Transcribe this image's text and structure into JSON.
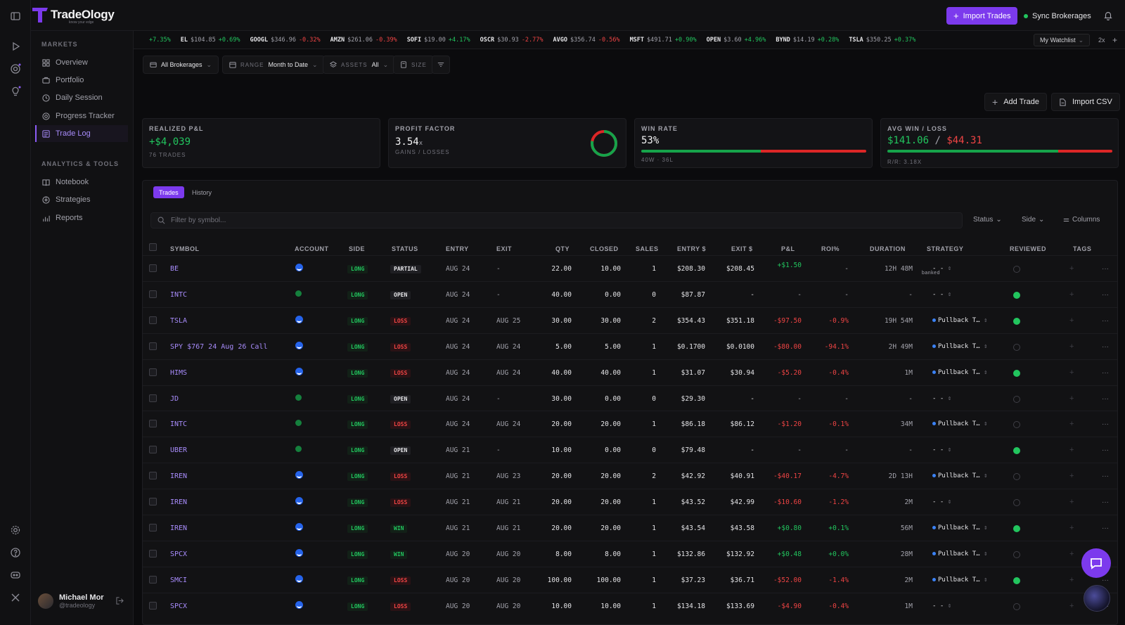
{
  "brand": {
    "name": "TradeOlogy",
    "tagline": "know your edge",
    "color": "#7c3aed"
  },
  "header": {
    "import_label": "Import Trades",
    "sync_label": "Sync Brokerages"
  },
  "sidebar": {
    "markets_title": "MARKETS",
    "markets": [
      {
        "label": "Overview",
        "icon": "grid-icon"
      },
      {
        "label": "Portfolio",
        "icon": "briefcase-icon"
      },
      {
        "label": "Daily Session",
        "icon": "clock-icon"
      },
      {
        "label": "Progress Tracker",
        "icon": "target-icon"
      },
      {
        "label": "Trade Log",
        "icon": "log-icon",
        "active": true
      }
    ],
    "tools_title": "ANALYTICS & TOOLS",
    "tools": [
      {
        "label": "Notebook",
        "icon": "book-icon"
      },
      {
        "label": "Strategies",
        "icon": "strategy-icon"
      },
      {
        "label": "Reports",
        "icon": "chart-icon"
      }
    ],
    "user": {
      "name": "Michael Mor",
      "handle": "@tradeology"
    }
  },
  "ticker": [
    {
      "sym": "",
      "price": "",
      "chg": "+7.35%",
      "up": true
    },
    {
      "sym": "EL",
      "price": "$104.85",
      "chg": "+0.69%",
      "up": true
    },
    {
      "sym": "GOOGL",
      "price": "$346.96",
      "chg": "-0.32%",
      "up": false
    },
    {
      "sym": "AMZN",
      "price": "$261.06",
      "chg": "-0.39%",
      "up": false
    },
    {
      "sym": "SOFI",
      "price": "$19.00",
      "chg": "+4.17%",
      "up": true
    },
    {
      "sym": "OSCR",
      "price": "$30.93",
      "chg": "-2.77%",
      "up": false
    },
    {
      "sym": "AVGO",
      "price": "$356.74",
      "chg": "-0.56%",
      "up": false
    },
    {
      "sym": "MSFT",
      "price": "$491.71",
      "chg": "+0.90%",
      "up": true
    },
    {
      "sym": "OPEN",
      "price": "$3.60",
      "chg": "+4.96%",
      "up": true
    },
    {
      "sym": "BYND",
      "price": "$14.19",
      "chg": "+0.28%",
      "up": true
    },
    {
      "sym": "TSLA",
      "price": "$350.25",
      "chg": "+0.37%",
      "up": true
    }
  ],
  "ticker_controls": {
    "watchlist": "My Watchlist",
    "speed": "2x"
  },
  "filters": {
    "brokerage": "All Brokerages",
    "range_label": "RANGE",
    "range_value": "Month to Date",
    "assets_label": "ASSETS",
    "assets_value": "All",
    "size_label": "SIZE"
  },
  "actions": {
    "add_trade": "Add Trade",
    "import_csv": "Import CSV"
  },
  "stats": {
    "realized": {
      "title": "REALIZED P&L",
      "value": "+$4,039",
      "sub": "76 TRADES"
    },
    "profit_factor": {
      "title": "PROFIT FACTOR",
      "value": "3.54",
      "suffix": "x",
      "sub": "GAINS / LOSSES",
      "ratio": 0.78
    },
    "win_rate": {
      "title": "WIN RATE",
      "value": "53%",
      "sub": "40W · 36L",
      "fraction": 0.53
    },
    "avg": {
      "title": "AVG WIN / LOSS",
      "win": "$141.06",
      "sep": "/",
      "loss": "$44.31",
      "sub": "R/R: 3.18X",
      "fraction": 0.76
    }
  },
  "tabs": {
    "trades": "Trades",
    "history": "History"
  },
  "search": {
    "placeholder": "Filter by symbol..."
  },
  "dropdowns": {
    "status": "Status",
    "side": "Side",
    "columns": "Columns"
  },
  "columns": {
    "symbol": "SYMBOL",
    "account": "ACCOUNT",
    "side": "SIDE",
    "status": "STATUS",
    "entry": "ENTRY",
    "exit": "EXIT",
    "qty": "QTY",
    "closed": "CLOSED",
    "sales": "SALES",
    "entry_price": "ENTRY $",
    "exit_price": "EXIT $",
    "pnl": "P&L",
    "roi": "ROI%",
    "duration": "DURATION",
    "strategy": "STRATEGY",
    "reviewed": "REVIEWED",
    "tags": "TAGS"
  },
  "trades": [
    {
      "symbol": "BE",
      "acct": "blue",
      "side": "LONG",
      "status": "PARTIAL",
      "entry": "AUG 24",
      "exit": "-",
      "qty": "22.00",
      "closed": "10.00",
      "sales": "1",
      "entry_price": "$208.30",
      "exit_price": "$208.45",
      "pnl": "+$1.50",
      "pnl_note": "banked",
      "roi": "-",
      "duration": "12H 48M",
      "strategy": "- -",
      "reviewed": false
    },
    {
      "symbol": "INTC",
      "acct": "green",
      "side": "LONG",
      "status": "OPEN",
      "entry": "AUG 24",
      "exit": "-",
      "qty": "40.00",
      "closed": "0.00",
      "sales": "0",
      "entry_price": "$87.87",
      "exit_price": "-",
      "pnl": "-",
      "pnl_note": "",
      "roi": "-",
      "duration": "-",
      "strategy": "- -",
      "reviewed": true
    },
    {
      "symbol": "TSLA",
      "acct": "blue",
      "side": "LONG",
      "status": "LOSS",
      "entry": "AUG 24",
      "exit": "AUG 25",
      "qty": "30.00",
      "closed": "30.00",
      "sales": "2",
      "entry_price": "$354.43",
      "exit_price": "$351.18",
      "pnl": "-$97.50",
      "pnl_note": "",
      "roi": "-0.9%",
      "duration": "19H 54M",
      "strategy": "Pullback T…",
      "reviewed": true
    },
    {
      "symbol": "SPY $767 24 Aug 26 Call",
      "acct": "blue",
      "side": "LONG",
      "status": "LOSS",
      "entry": "AUG 24",
      "exit": "AUG 24",
      "qty": "5.00",
      "closed": "5.00",
      "sales": "1",
      "entry_price": "$0.1700",
      "exit_price": "$0.0100",
      "pnl": "-$80.00",
      "pnl_note": "",
      "roi": "-94.1%",
      "duration": "2H 49M",
      "strategy": "Pullback T…",
      "reviewed": false
    },
    {
      "symbol": "HIMS",
      "acct": "blue",
      "side": "LONG",
      "status": "LOSS",
      "entry": "AUG 24",
      "exit": "AUG 24",
      "qty": "40.00",
      "closed": "40.00",
      "sales": "1",
      "entry_price": "$31.07",
      "exit_price": "$30.94",
      "pnl": "-$5.20",
      "pnl_note": "",
      "roi": "-0.4%",
      "duration": "1M",
      "strategy": "Pullback T…",
      "reviewed": true
    },
    {
      "symbol": "JD",
      "acct": "green",
      "side": "LONG",
      "status": "OPEN",
      "entry": "AUG 24",
      "exit": "-",
      "qty": "30.00",
      "closed": "0.00",
      "sales": "0",
      "entry_price": "$29.30",
      "exit_price": "-",
      "pnl": "-",
      "pnl_note": "",
      "roi": "-",
      "duration": "-",
      "strategy": "- -",
      "reviewed": false
    },
    {
      "symbol": "INTC",
      "acct": "green",
      "side": "LONG",
      "status": "LOSS",
      "entry": "AUG 24",
      "exit": "AUG 24",
      "qty": "20.00",
      "closed": "20.00",
      "sales": "1",
      "entry_price": "$86.18",
      "exit_price": "$86.12",
      "pnl": "-$1.20",
      "pnl_note": "",
      "roi": "-0.1%",
      "duration": "34M",
      "strategy": "Pullback T…",
      "reviewed": false
    },
    {
      "symbol": "UBER",
      "acct": "green",
      "side": "LONG",
      "status": "OPEN",
      "entry": "AUG 21",
      "exit": "-",
      "qty": "10.00",
      "closed": "0.00",
      "sales": "0",
      "entry_price": "$79.48",
      "exit_price": "-",
      "pnl": "-",
      "pnl_note": "",
      "roi": "-",
      "duration": "-",
      "strategy": "- -",
      "reviewed": true
    },
    {
      "symbol": "IREN",
      "acct": "blue",
      "side": "LONG",
      "status": "LOSS",
      "entry": "AUG 21",
      "exit": "AUG 23",
      "qty": "20.00",
      "closed": "20.00",
      "sales": "2",
      "entry_price": "$42.92",
      "exit_price": "$40.91",
      "pnl": "-$40.17",
      "pnl_note": "",
      "roi": "-4.7%",
      "duration": "2D 13H",
      "strategy": "Pullback T…",
      "reviewed": false
    },
    {
      "symbol": "IREN",
      "acct": "blue",
      "side": "LONG",
      "status": "LOSS",
      "entry": "AUG 21",
      "exit": "AUG 21",
      "qty": "20.00",
      "closed": "20.00",
      "sales": "1",
      "entry_price": "$43.52",
      "exit_price": "$42.99",
      "pnl": "-$10.60",
      "pnl_note": "",
      "roi": "-1.2%",
      "duration": "2M",
      "strategy": "- -",
      "reviewed": false
    },
    {
      "symbol": "IREN",
      "acct": "blue",
      "side": "LONG",
      "status": "WIN",
      "entry": "AUG 21",
      "exit": "AUG 21",
      "qty": "20.00",
      "closed": "20.00",
      "sales": "1",
      "entry_price": "$43.54",
      "exit_price": "$43.58",
      "pnl": "+$0.80",
      "pnl_note": "",
      "roi": "+0.1%",
      "duration": "56M",
      "strategy": "Pullback T…",
      "reviewed": true
    },
    {
      "symbol": "SPCX",
      "acct": "blue",
      "side": "LONG",
      "status": "WIN",
      "entry": "AUG 20",
      "exit": "AUG 20",
      "qty": "8.00",
      "closed": "8.00",
      "sales": "1",
      "entry_price": "$132.86",
      "exit_price": "$132.92",
      "pnl": "+$0.48",
      "pnl_note": "",
      "roi": "+0.0%",
      "duration": "28M",
      "strategy": "Pullback T…",
      "reviewed": false
    },
    {
      "symbol": "SMCI",
      "acct": "blue",
      "side": "LONG",
      "status": "LOSS",
      "entry": "AUG 20",
      "exit": "AUG 20",
      "qty": "100.00",
      "closed": "100.00",
      "sales": "1",
      "entry_price": "$37.23",
      "exit_price": "$36.71",
      "pnl": "-$52.00",
      "pnl_note": "",
      "roi": "-1.4%",
      "duration": "2M",
      "strategy": "Pullback T…",
      "reviewed": true
    },
    {
      "symbol": "SPCX",
      "acct": "blue",
      "side": "LONG",
      "status": "LOSS",
      "entry": "AUG 20",
      "exit": "AUG 20",
      "qty": "10.00",
      "closed": "10.00",
      "sales": "1",
      "entry_price": "$134.18",
      "exit_price": "$133.69",
      "pnl": "-$4.90",
      "pnl_note": "",
      "roi": "-0.4%",
      "duration": "1M",
      "strategy": "- -",
      "reviewed": false
    }
  ]
}
